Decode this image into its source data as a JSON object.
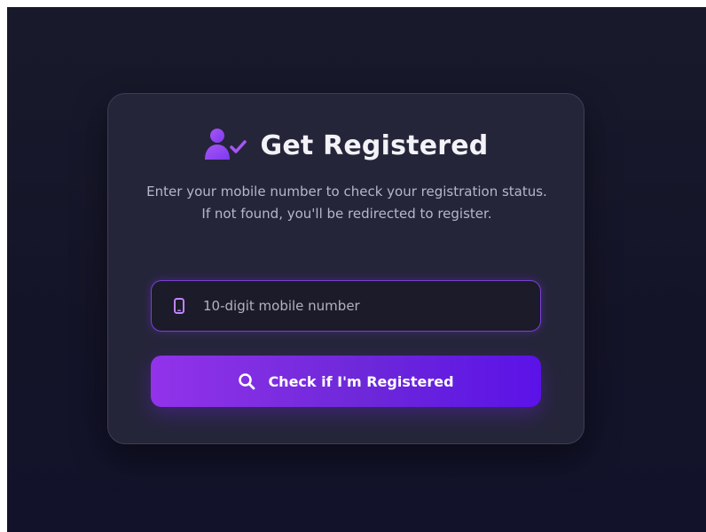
{
  "colors": {
    "background": "#16162a",
    "card": "#25253a",
    "accent": "#7c3aed",
    "accent_light": "#9233ea",
    "text_primary": "#f2f2f7",
    "text_secondary": "#b7b7c8"
  },
  "card": {
    "title_icon": "user-check-icon",
    "title": "Get Registered",
    "subtitle": "Enter your mobile number to check your registration status. If not found, you'll be redirected to register."
  },
  "form": {
    "mobile_input": {
      "icon": "phone-icon",
      "placeholder": "10-digit mobile number",
      "value": ""
    },
    "submit_button": {
      "icon": "search-icon",
      "label": "Check if I'm Registered"
    }
  }
}
